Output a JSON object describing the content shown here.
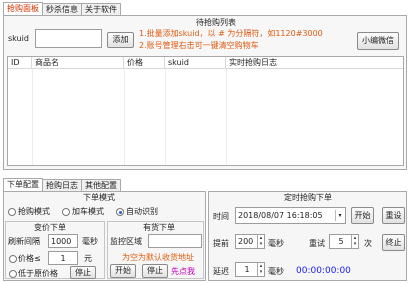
{
  "top_tabs": [
    "抢购面板",
    "秒杀信息",
    "关于软件"
  ],
  "list_title": "待抢购列表",
  "skuid_label": "skuid",
  "skuid_value": "",
  "add_button": "添加",
  "hint_line1": "1.批量添加skuid，以 # 为分隔符，如1120#3000",
  "hint_line2": "2.账号管理右击可一键清空购物车",
  "wechat_button": "小编微信",
  "table_columns": [
    "ID",
    "商品名",
    "价格",
    "skuid",
    "实时抢购日志"
  ],
  "bottom_tabs": [
    "下单配置",
    "抢购日志",
    "其他配置"
  ],
  "order_mode": {
    "title": "下单模式",
    "options": [
      "抢购模式",
      "加车模式",
      "自动识别"
    ],
    "selected_index": 2
  },
  "price_order": {
    "title": "变价下单",
    "refresh_label": "刷新间隔",
    "refresh_value": "1000",
    "refresh_unit": "毫秒",
    "price_radio_label": "价格≤",
    "price_value": "1",
    "price_unit": "元",
    "low_price_label": "低于原价格",
    "stop_button": "停止"
  },
  "stock_order": {
    "title": "有货下单",
    "monitor_label": "监控区域",
    "monitor_value": "",
    "default_hint": "为空为默认收货地址",
    "start_button": "开始",
    "stop_button": "停止",
    "click_first": "先点我"
  },
  "timed_order": {
    "title": "定时抢购下单",
    "time_label": "时间",
    "time_value": "2018/08/07 16:18:05",
    "start_button": "开始",
    "reset_button": "重设",
    "advance_label": "提前",
    "advance_value": "200",
    "advance_unit": "毫秒",
    "retry_label": "重试",
    "retry_value": "5",
    "retry_unit": "次",
    "terminate_button": "终止",
    "delay_label": "延迟",
    "delay_value": "1",
    "delay_unit": "毫秒",
    "countdown": "00:00:00:00"
  }
}
